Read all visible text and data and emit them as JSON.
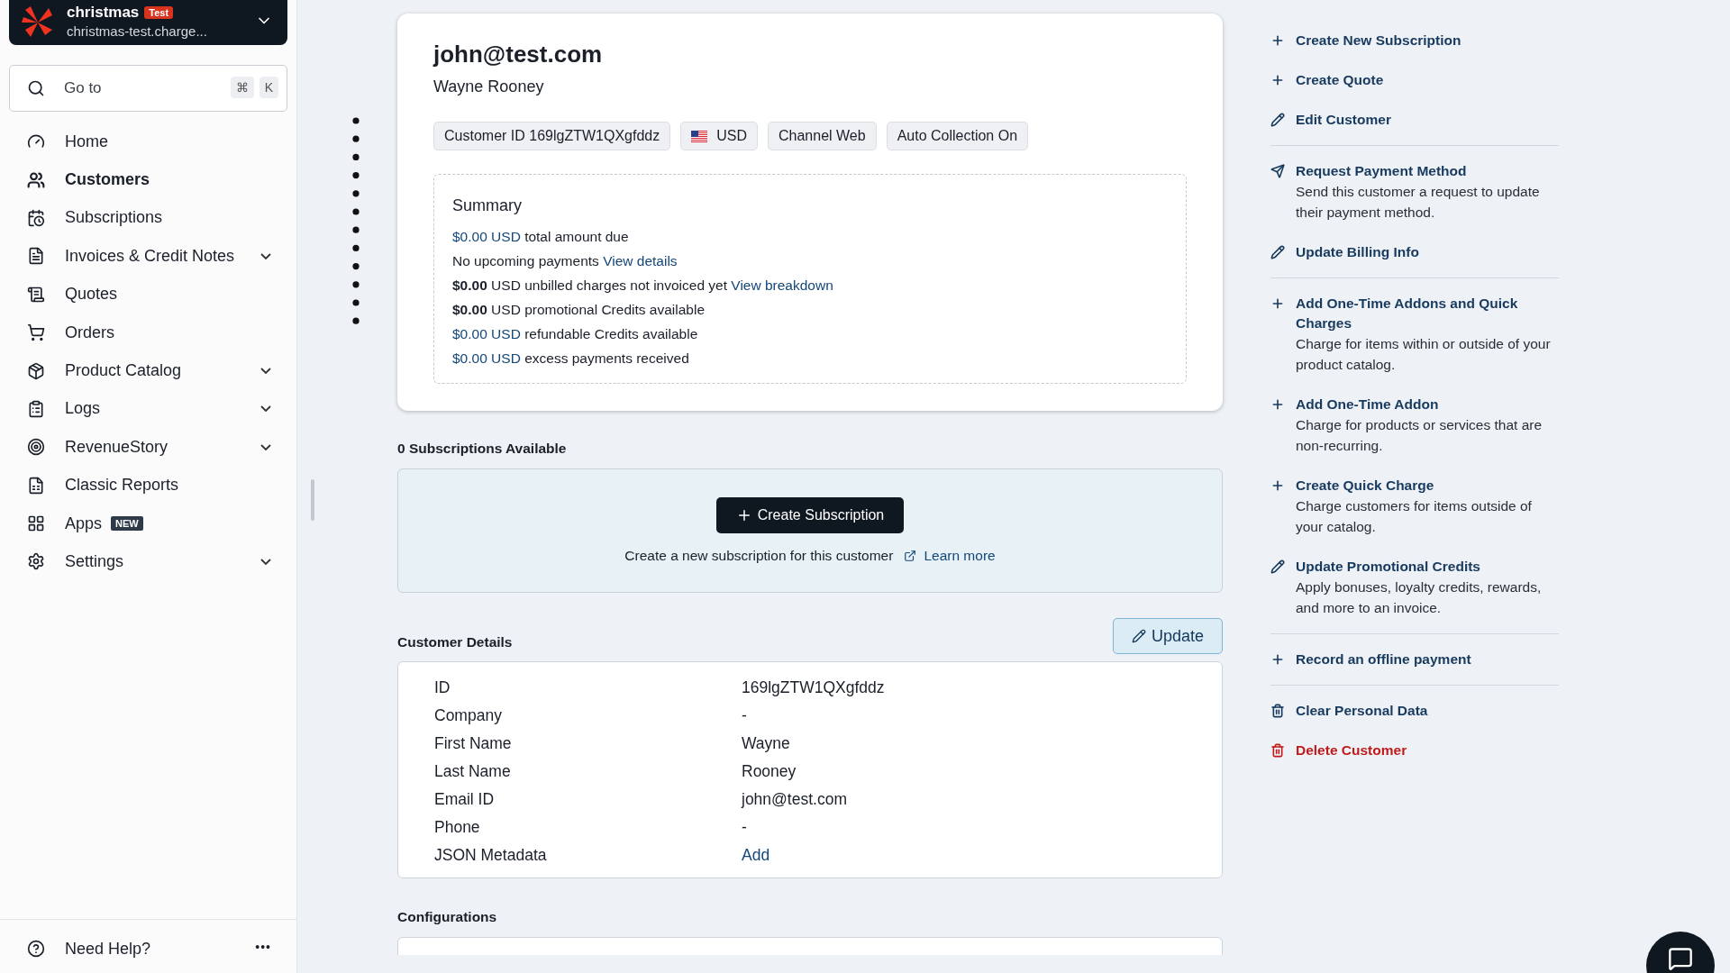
{
  "org": {
    "name": "christmas",
    "badge": "Test",
    "domain": "christmas-test.charge..."
  },
  "search": {
    "placeholder": "Go to",
    "keys": [
      "⌘",
      "K"
    ]
  },
  "nav": [
    {
      "label": "Home",
      "selected": false,
      "expandable": false
    },
    {
      "label": "Customers",
      "selected": true,
      "expandable": false
    },
    {
      "label": "Subscriptions",
      "selected": false,
      "expandable": false
    },
    {
      "label": "Invoices & Credit Notes",
      "selected": false,
      "expandable": true
    },
    {
      "label": "Quotes",
      "selected": false,
      "expandable": false
    },
    {
      "label": "Orders",
      "selected": false,
      "expandable": false
    },
    {
      "label": "Product Catalog",
      "selected": false,
      "expandable": true
    },
    {
      "label": "Logs",
      "selected": false,
      "expandable": true
    },
    {
      "label": "RevenueStory",
      "selected": false,
      "expandable": true
    },
    {
      "label": "Classic Reports",
      "selected": false,
      "expandable": false
    },
    {
      "label": "Apps",
      "selected": false,
      "expandable": false,
      "badge": "NEW"
    },
    {
      "label": "Settings",
      "selected": false,
      "expandable": true
    }
  ],
  "help": {
    "label": "Need Help?",
    "more": "•••"
  },
  "customer": {
    "email": "john@test.com",
    "name": "Wayne Rooney",
    "tags": [
      {
        "kind": "plain",
        "text": "Customer ID 169lgZTW1QXgfddz"
      },
      {
        "kind": "flag",
        "text": "USD"
      },
      {
        "kind": "plain",
        "text": "Channel Web"
      },
      {
        "kind": "plain",
        "text": "Auto Collection On"
      }
    ],
    "summary": {
      "title": "Summary",
      "rows": [
        {
          "kind": "amount-link",
          "amount": "$0.00 USD",
          "text": "total amount due"
        },
        {
          "kind": "plain",
          "text": "No upcoming payments",
          "link": "View details"
        },
        {
          "kind": "plain",
          "text": "**$0.00** USD unbilled charges not invoiced yet",
          "link": "View breakdown"
        },
        {
          "kind": "plain",
          "text": "**$0.00** USD promotional Credits available"
        },
        {
          "kind": "amount-link",
          "amount": "$0.00 USD",
          "text": "refundable Credits available"
        },
        {
          "kind": "amount-link",
          "amount": "$0.00 USD",
          "text": "excess payments received"
        }
      ]
    }
  },
  "subscriptions": {
    "heading": "0 Subscriptions Available",
    "button": "Create Subscription",
    "text": "Create a new subscription for this customer",
    "link": "Learn more"
  },
  "details": {
    "heading": "Customer Details",
    "button": "Update",
    "rows": [
      {
        "label": "ID",
        "value": "169lgZTW1QXgfddz",
        "kind": "text"
      },
      {
        "label": "Company",
        "value": "-",
        "kind": "text"
      },
      {
        "label": "First Name",
        "value": "Wayne",
        "kind": "text"
      },
      {
        "label": "Last Name",
        "value": "Rooney",
        "kind": "text"
      },
      {
        "label": "Email ID",
        "value": "john@test.com",
        "kind": "text"
      },
      {
        "label": "Phone",
        "value": "-",
        "kind": "text"
      },
      {
        "label": "JSON Metadata",
        "value": "Add",
        "kind": "link"
      }
    ]
  },
  "configurations": {
    "heading": "Configurations"
  },
  "actions": [
    [
      {
        "kind": "create",
        "title": "Create New Subscription",
        "danger": false
      },
      {
        "kind": "create",
        "title": "Create Quote",
        "danger": false
      },
      {
        "kind": "edit",
        "title": "Edit Customer",
        "danger": false
      }
    ],
    [
      {
        "kind": "send",
        "title": "Request Payment Method",
        "description": "Send this customer a request to update their payment method.",
        "danger": false
      },
      {
        "kind": "edit",
        "title": "Update Billing Info",
        "danger": false
      }
    ],
    [
      {
        "kind": "create",
        "title": "Add One-Time Addons and Quick Charges",
        "description": "Charge for items within or outside of your product catalog.",
        "danger": false
      },
      {
        "kind": "create",
        "title": "Add One-Time Addon",
        "description": "Charge for products or services that are non-recurring.",
        "danger": false
      },
      {
        "kind": "create",
        "title": "Create Quick Charge",
        "description": "Charge customers for items outside of your catalog.",
        "danger": false
      },
      {
        "kind": "edit",
        "title": "Update Promotional Credits",
        "description": "Apply bonuses, loyalty credits, rewards, and more to an invoice.",
        "danger": false
      }
    ],
    [
      {
        "kind": "create",
        "title": "Record an offline payment",
        "danger": false
      }
    ],
    [
      {
        "kind": "delete",
        "title": "Clear Personal Data",
        "danger": false
      },
      {
        "kind": "delete",
        "title": "Delete Customer",
        "danger": true
      }
    ]
  ]
}
